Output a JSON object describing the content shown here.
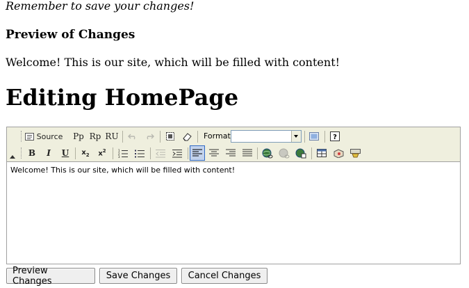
{
  "reminder": "Remember to save your changes!",
  "preview": {
    "heading": "Preview of Changes",
    "text": "Welcome! This is our site, which will be filled with content!"
  },
  "page_title": "Editing HomePage",
  "toolbar": {
    "source_label": "Source",
    "paste_text_label": "Pp",
    "paste_word_label": "Rp",
    "remove_format_label": "RU",
    "format_label": "Format",
    "format_value": "",
    "bold": "B",
    "italic": "I",
    "underline": "U",
    "subscript": "x",
    "subscript_mark": "2",
    "superscript": "x",
    "superscript_mark": "2",
    "active_button": "align-left",
    "accent_color": "#316ac5",
    "toolbar_bg": "#efefde"
  },
  "editor": {
    "content": "Welcome! This is our site, which will be filled with content!"
  },
  "actions": {
    "preview": "Preview Changes",
    "save": "Save Changes",
    "cancel": "Cancel Changes"
  }
}
